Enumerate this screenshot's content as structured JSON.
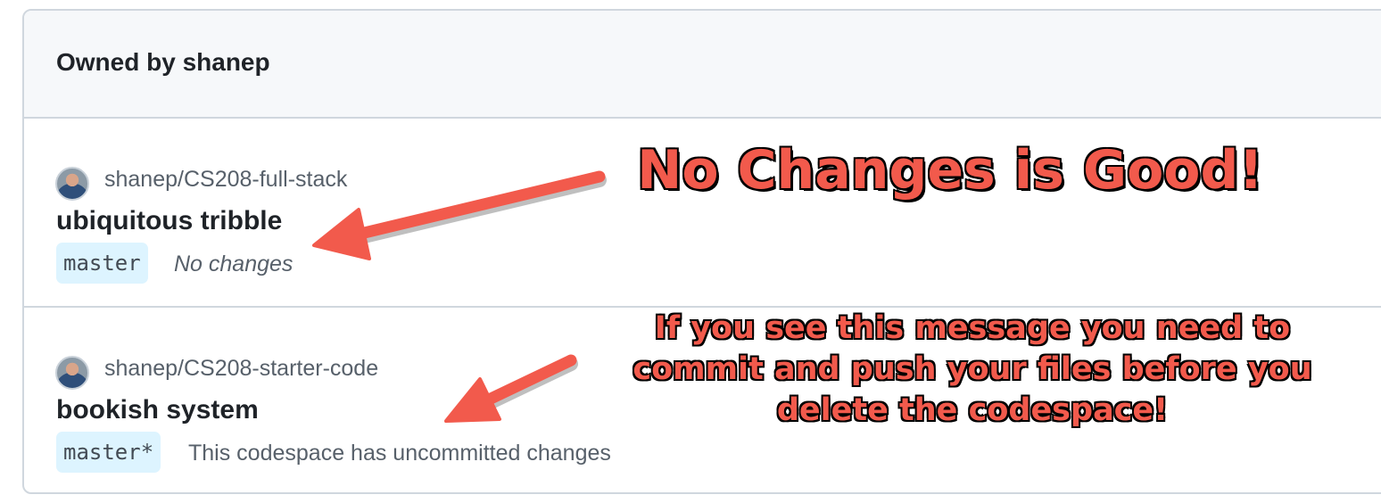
{
  "section": {
    "title": "Owned by shanep"
  },
  "codespaces": [
    {
      "repo": "shanep/CS208-full-stack",
      "name": "ubiquitous tribble",
      "branch": "master",
      "status": "No changes"
    },
    {
      "repo": "shanep/CS208-starter-code",
      "name": "bookish system",
      "branch": "master*",
      "status": "This codespace has uncommitted changes"
    }
  ],
  "annotations": {
    "headline": "No Changes is Good!",
    "warning": "If you see this message you need to commit and push your files before you delete the codespace!"
  },
  "colors": {
    "annotation_fill": "#f25a4c",
    "annotation_outline": "#000000",
    "branch_badge_bg": "#ddf4ff",
    "header_bg": "#f6f8fa",
    "border": "#d0d7de"
  }
}
